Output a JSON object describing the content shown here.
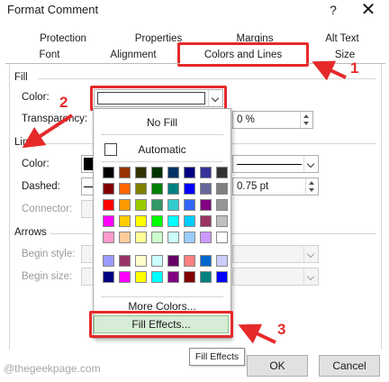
{
  "title": "Format Comment",
  "help_label": "?",
  "close_label": "✕",
  "tabs_row1": [
    "Protection",
    "Properties",
    "Margins",
    "Alt Text"
  ],
  "tabs_row2": [
    "Font",
    "Alignment",
    "Colors and Lines",
    "Size"
  ],
  "fill": {
    "section": "Fill",
    "color_label": "Color:",
    "transparency_label": "Transparency:",
    "transparency_value": "0 %"
  },
  "line": {
    "section": "Line",
    "color_label": "Color:",
    "dashed_label": "Dashed:",
    "connector_label": "Connector:",
    "weight_value": "0.75 pt"
  },
  "arrows": {
    "section": "Arrows",
    "begin_style_label": "Begin style:",
    "begin_size_label": "Begin size:"
  },
  "dropdown": {
    "no_fill": "No Fill",
    "automatic": "Automatic",
    "more_colors": "More Colors...",
    "fill_effects": "Fill Effects...",
    "swatches": [
      [
        "#000000",
        "#993300",
        "#333300",
        "#003300",
        "#003366",
        "#000080",
        "#333399",
        "#333333"
      ],
      [
        "#800000",
        "#FF6600",
        "#808000",
        "#008000",
        "#008080",
        "#0000FF",
        "#666699",
        "#808080"
      ],
      [
        "#FF0000",
        "#FF9900",
        "#99CC00",
        "#339966",
        "#33CCCC",
        "#3366FF",
        "#800080",
        "#969696"
      ],
      [
        "#FF00FF",
        "#FFCC00",
        "#FFFF00",
        "#00FF00",
        "#00FFFF",
        "#00CCFF",
        "#993366",
        "#C0C0C0"
      ],
      [
        "#FF99CC",
        "#FFCC99",
        "#FFFF99",
        "#CCFFCC",
        "#CCFFFF",
        "#99CCFF",
        "#CC99FF",
        "#FFFFFF"
      ],
      [
        "#9999FF",
        "#993366",
        "#FFFFCC",
        "#CCFFFF",
        "#660066",
        "#FF8080",
        "#0066CC",
        "#CCCCFF"
      ],
      [
        "#000080",
        "#FF00FF",
        "#FFFF00",
        "#00FFFF",
        "#800080",
        "#800000",
        "#008080",
        "#0000FF"
      ]
    ]
  },
  "tooltip": "Fill Effects",
  "ok_label": "OK",
  "cancel_label": "Cancel",
  "annotations": [
    "1",
    "2",
    "3"
  ],
  "watermark": "@thegeekpage.com",
  "highlight_color": "#e52a2a"
}
